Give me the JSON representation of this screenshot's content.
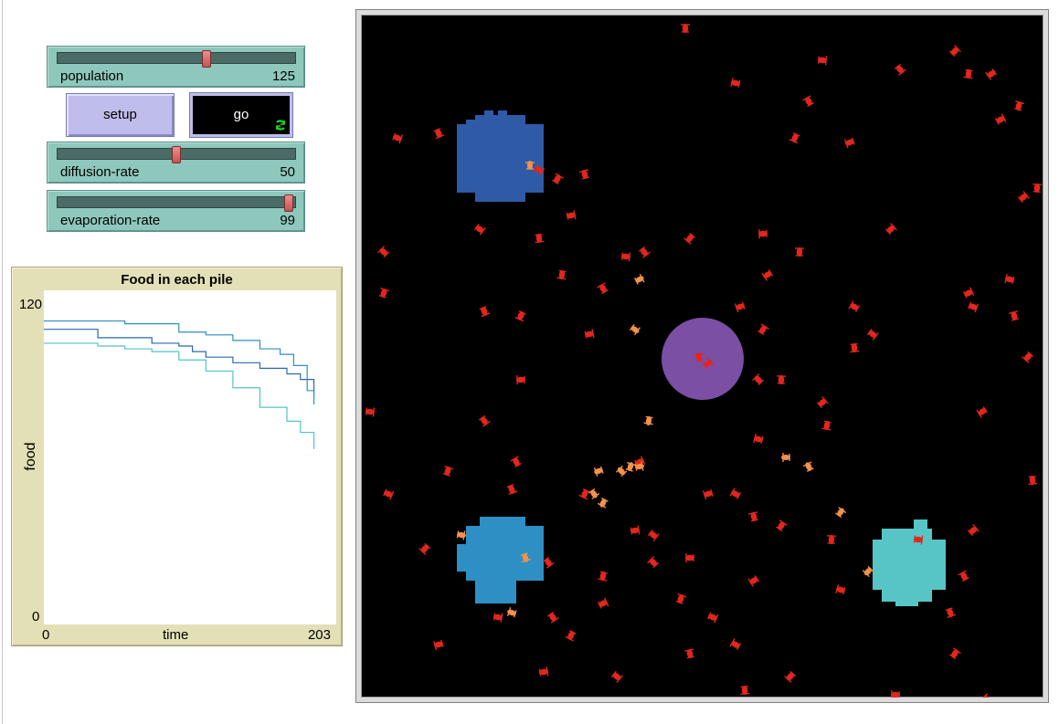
{
  "sliders": [
    {
      "name": "population-slider",
      "label": "population",
      "value": "125",
      "level": 0.63
    },
    {
      "name": "diffusion-rate-slider",
      "label": "diffusion-rate",
      "value": "50",
      "level": 0.5
    },
    {
      "name": "evaporation-rate-slider",
      "label": "evaporation-rate",
      "value": "99",
      "level": 0.99
    }
  ],
  "buttons": {
    "setup_label": "setup",
    "go_label": "go"
  },
  "plot": {
    "title": "Food in each pile",
    "ymax_label": "120",
    "ymin_label": "0",
    "xmin_label": "0",
    "xmax_label": "203",
    "xlabel": "time",
    "ylabel": "food"
  },
  "colors": {
    "pile1": "#2f5aa8",
    "pile2": "#2e8fc4",
    "pile3": "#57c5c5",
    "nest": "#7b4fa3",
    "ant": "#e2261d",
    "ant_carrying": "#f4914a",
    "series1": "#2a68b0",
    "series2": "#2e8fc4",
    "series3": "#52c4c4"
  },
  "chart_data": {
    "type": "line",
    "title": "Food in each pile",
    "xlabel": "time",
    "ylabel": "food",
    "xlim": [
      0,
      203
    ],
    "ylim": [
      0,
      120
    ],
    "series": [
      {
        "color": "#2a68b0",
        "x": [
          0,
          20,
          40,
          60,
          80,
          100,
          110,
          120,
          140,
          160,
          180,
          190,
          200
        ],
        "y": [
          106,
          106,
          103,
          103,
          101,
          100,
          98,
          96,
          94,
          92,
          90,
          88,
          82
        ]
      },
      {
        "color": "#2e8fc4",
        "x": [
          0,
          20,
          40,
          60,
          80,
          100,
          120,
          140,
          160,
          175,
          185,
          195,
          200
        ],
        "y": [
          109,
          109,
          109,
          108,
          108,
          105,
          104,
          102,
          99,
          97,
          93,
          84,
          79
        ]
      },
      {
        "color": "#52c4c4",
        "x": [
          0,
          20,
          40,
          60,
          80,
          100,
          120,
          140,
          160,
          180,
          190,
          200
        ],
        "y": [
          101,
          101,
          100,
          99,
          98,
          95,
          91,
          85,
          78,
          73,
          69,
          63
        ]
      }
    ]
  }
}
